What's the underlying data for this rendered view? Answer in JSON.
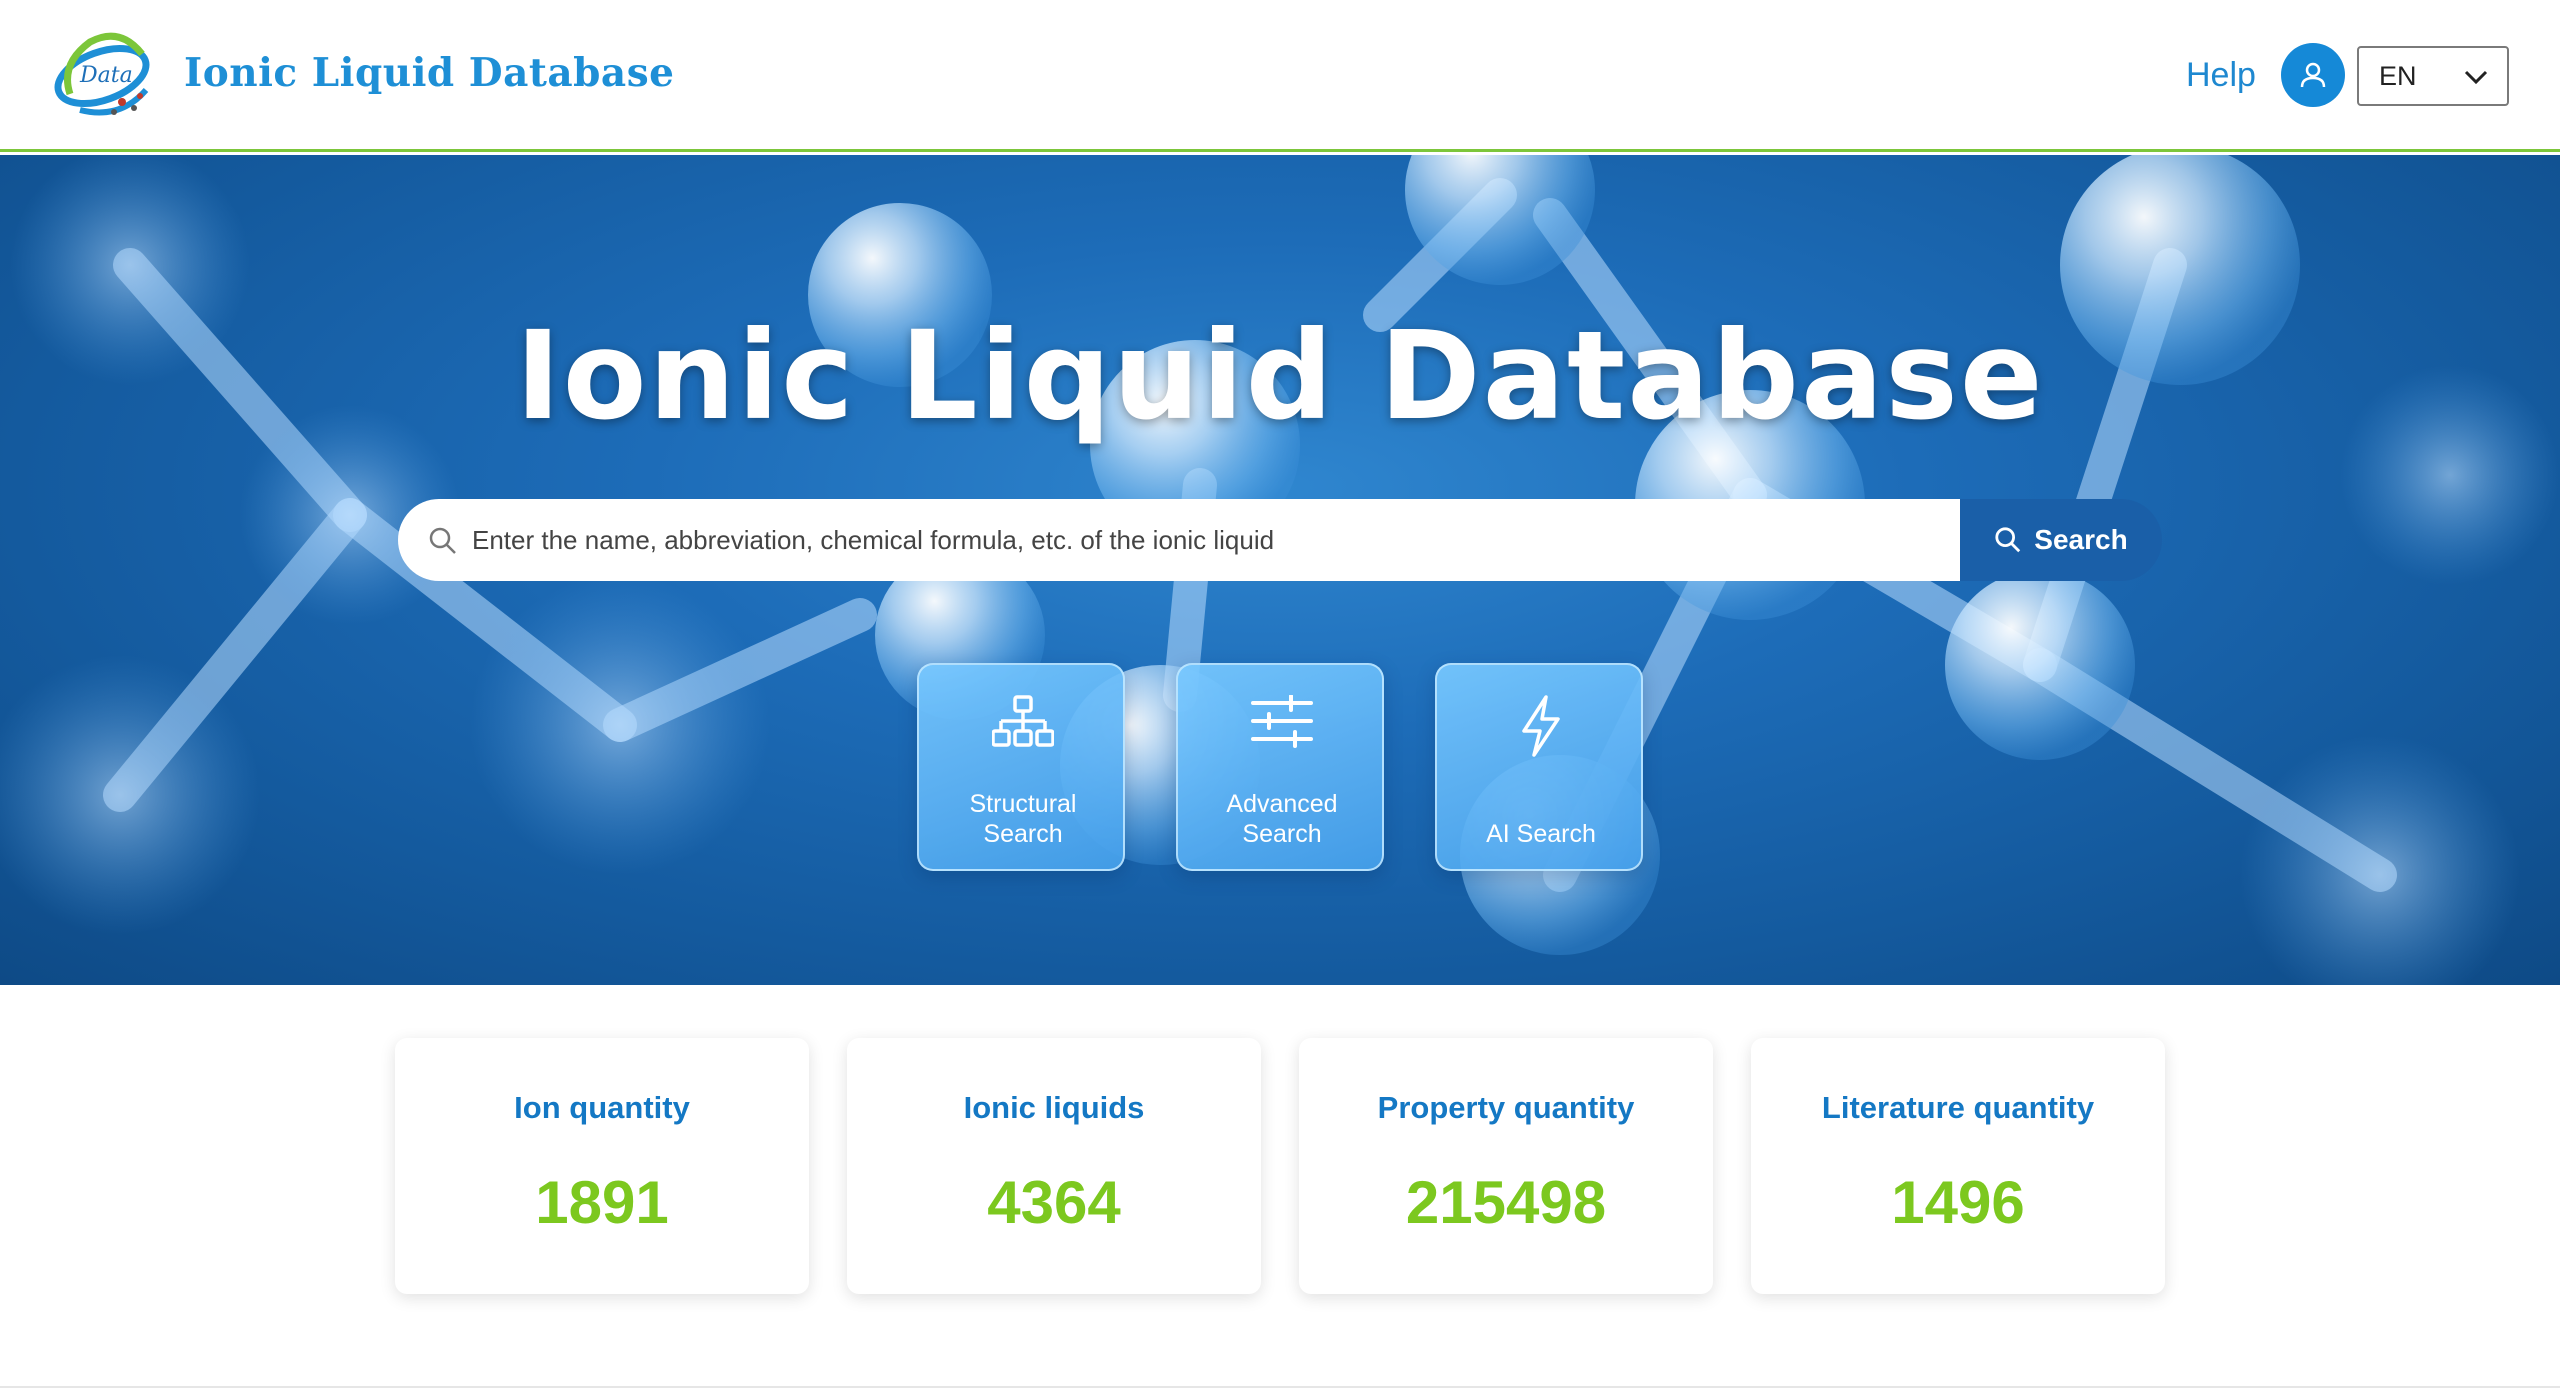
{
  "header": {
    "brand": "Ionic Liquid Database",
    "logo_text": "Data",
    "help": "Help",
    "user_icon": "user-icon",
    "language": "EN"
  },
  "hero": {
    "title": "Ionic Liquid Database",
    "search": {
      "placeholder": "Enter the name, abbreviation, chemical formula, etc. of the ionic liquid",
      "button_label": "Search"
    },
    "tiles": [
      {
        "line1": "Structural",
        "line2": "Search",
        "icon": "hierarchy-icon"
      },
      {
        "line1": "Advanced",
        "line2": "Search",
        "icon": "sliders-icon"
      },
      {
        "line1": "",
        "line2": "AI Search",
        "icon": "lightning-icon"
      }
    ]
  },
  "stats": [
    {
      "label": "Ion quantity",
      "value": "1891"
    },
    {
      "label": "Ionic liquids",
      "value": "4364"
    },
    {
      "label": "Property quantity",
      "value": "215498"
    },
    {
      "label": "Literature quantity",
      "value": "1496"
    }
  ],
  "colors": {
    "brand_blue": "#1e8fd6",
    "accent_green": "#7cc81f",
    "search_button": "#1a5fa8"
  }
}
